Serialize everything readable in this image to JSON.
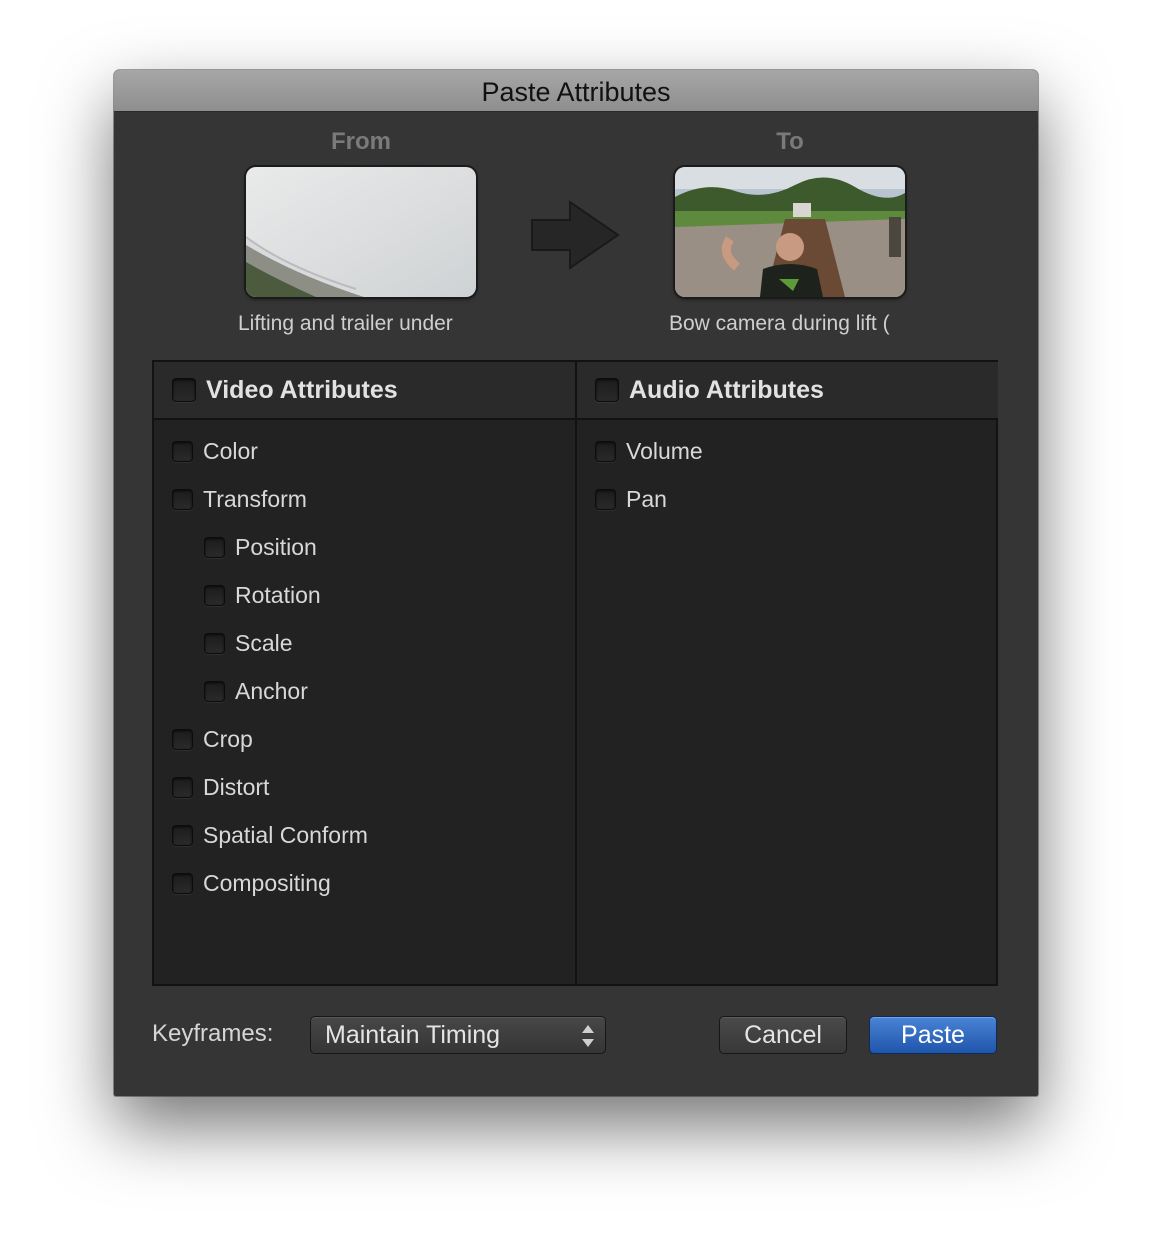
{
  "window": {
    "title": "Paste Attributes"
  },
  "source": {
    "label": "From",
    "clip_name": "Lifting and trailer under"
  },
  "destination": {
    "label": "To",
    "clip_name": "Bow camera during lift ("
  },
  "video": {
    "header": "Video Attributes",
    "items": [
      {
        "label": "Color"
      },
      {
        "label": "Transform"
      },
      {
        "label": "Position"
      },
      {
        "label": "Rotation"
      },
      {
        "label": "Scale"
      },
      {
        "label": "Anchor"
      },
      {
        "label": "Crop"
      },
      {
        "label": "Distort"
      },
      {
        "label": "Spatial Conform"
      },
      {
        "label": "Compositing"
      }
    ]
  },
  "audio": {
    "header": "Audio Attributes",
    "items": [
      {
        "label": "Volume"
      },
      {
        "label": "Pan"
      }
    ]
  },
  "footer": {
    "keyframes_label": "Keyframes:",
    "keyframes_value": "Maintain Timing",
    "cancel_label": "Cancel",
    "paste_label": "Paste"
  },
  "colors": {
    "dialog_bg": "#353535",
    "panel_bg": "#222222",
    "accent": "#2a62b8"
  },
  "icons": {
    "arrow": "right-arrow-icon",
    "stepper": "up-down-stepper-icon"
  }
}
